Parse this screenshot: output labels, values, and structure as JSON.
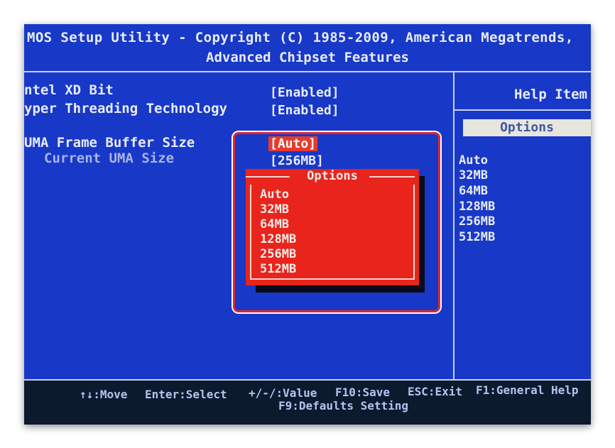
{
  "header": {
    "title": "MOS Setup Utility - Copyright (C) 1985-2009, American Megatrends,",
    "subtitle": "Advanced Chipset Features"
  },
  "settings": [
    {
      "label": "ntel XD Bit",
      "value": "[Enabled]"
    },
    {
      "label": "yper Threading Technology",
      "value": "[Enabled]"
    },
    {
      "label": "UMA Frame Buffer Size",
      "value": "[Auto]"
    },
    {
      "label": "Current UMA Size",
      "value": "[256MB]"
    }
  ],
  "popup": {
    "title": "Options",
    "options": [
      "Auto",
      "32MB",
      "64MB",
      "128MB",
      "256MB",
      "512MB"
    ]
  },
  "help_panel": {
    "title": "Help Item",
    "options_label": "Options",
    "options": [
      "Auto",
      "32MB",
      "64MB",
      "128MB",
      "256MB",
      "512MB"
    ]
  },
  "footer": {
    "move": "↑↓:Move",
    "enter": "Enter:Select",
    "value": "+/-/:Value",
    "save": "F10:Save",
    "exit": "ESC:Exit",
    "help": "F1:General Help",
    "defaults": "F9:Defaults Setting"
  },
  "colors": {
    "background": "#1838c8",
    "popup": "#e8241c",
    "highlight_frame": "#e0262c",
    "footer": "#0c1a2e"
  }
}
